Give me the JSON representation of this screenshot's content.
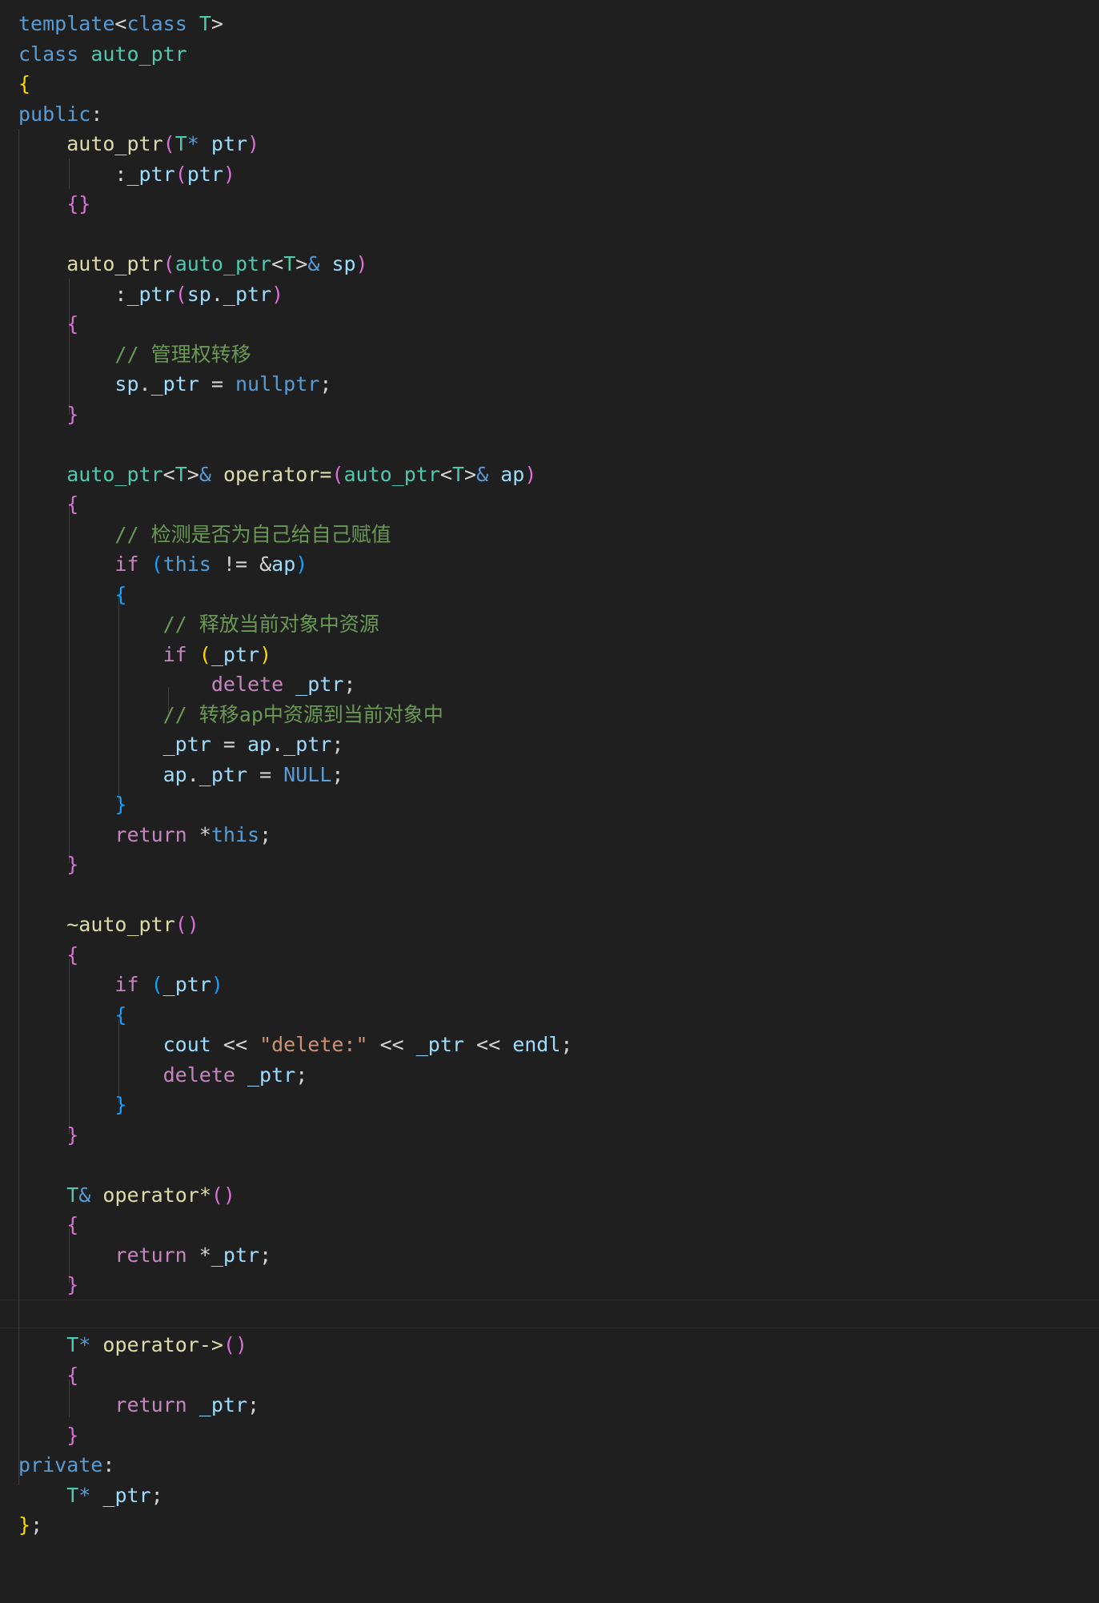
{
  "editor": {
    "language": "cpp",
    "theme_colors": {
      "background": "#1f1f1f",
      "keyword": "#569cd6",
      "control": "#c586c0",
      "type": "#4ec9b0",
      "function": "#dcdcaa",
      "variable": "#9cdcfe",
      "string": "#ce9178",
      "comment": "#6a9955",
      "text": "#d4d4d4",
      "bracket_level_1": "#ffd700",
      "bracket_level_2": "#da70d6",
      "bracket_level_3": "#179fff"
    },
    "lines": [
      [
        [
          "kw",
          "template"
        ],
        [
          "txt",
          "<"
        ],
        [
          "kw",
          "class"
        ],
        [
          "txt",
          " "
        ],
        [
          "type",
          "T"
        ],
        [
          "txt",
          ">"
        ]
      ],
      [
        [
          "kw",
          "class"
        ],
        [
          "txt",
          " "
        ],
        [
          "type",
          "auto_ptr"
        ]
      ],
      [
        [
          "b1",
          "{"
        ]
      ],
      [
        [
          "kw",
          "public"
        ],
        [
          "txt",
          ":"
        ]
      ],
      [
        [
          "txt",
          "    "
        ],
        [
          "fn",
          "auto_ptr"
        ],
        [
          "b2",
          "("
        ],
        [
          "type",
          "T"
        ],
        [
          "kw",
          "*"
        ],
        [
          "txt",
          " "
        ],
        [
          "var",
          "ptr"
        ],
        [
          "b2",
          ")"
        ]
      ],
      [
        [
          "txt",
          "        :"
        ],
        [
          "var",
          "_ptr"
        ],
        [
          "b2",
          "("
        ],
        [
          "var",
          "ptr"
        ],
        [
          "b2",
          ")"
        ]
      ],
      [
        [
          "txt",
          "    "
        ],
        [
          "b2",
          "{}"
        ]
      ],
      [],
      [
        [
          "txt",
          "    "
        ],
        [
          "fn",
          "auto_ptr"
        ],
        [
          "b2",
          "("
        ],
        [
          "type",
          "auto_ptr"
        ],
        [
          "txt",
          "<"
        ],
        [
          "type",
          "T"
        ],
        [
          "txt",
          ">"
        ],
        [
          "kw",
          "&"
        ],
        [
          "txt",
          " "
        ],
        [
          "var",
          "sp"
        ],
        [
          "b2",
          ")"
        ]
      ],
      [
        [
          "txt",
          "        :"
        ],
        [
          "var",
          "_ptr"
        ],
        [
          "b2",
          "("
        ],
        [
          "var",
          "sp"
        ],
        [
          "txt",
          "."
        ],
        [
          "var",
          "_ptr"
        ],
        [
          "b2",
          ")"
        ]
      ],
      [
        [
          "txt",
          "    "
        ],
        [
          "b2",
          "{"
        ]
      ],
      [
        [
          "txt",
          "        "
        ],
        [
          "com",
          "// 管理权转移"
        ]
      ],
      [
        [
          "txt",
          "        "
        ],
        [
          "var",
          "sp"
        ],
        [
          "txt",
          "."
        ],
        [
          "var",
          "_ptr"
        ],
        [
          "txt",
          " = "
        ],
        [
          "kw",
          "nullptr"
        ],
        [
          "txt",
          ";"
        ]
      ],
      [
        [
          "txt",
          "    "
        ],
        [
          "b2",
          "}"
        ]
      ],
      [],
      [
        [
          "txt",
          "    "
        ],
        [
          "type",
          "auto_ptr"
        ],
        [
          "txt",
          "<"
        ],
        [
          "type",
          "T"
        ],
        [
          "txt",
          ">"
        ],
        [
          "kw",
          "&"
        ],
        [
          "txt",
          " "
        ],
        [
          "fn",
          "operator="
        ],
        [
          "b2",
          "("
        ],
        [
          "type",
          "auto_ptr"
        ],
        [
          "txt",
          "<"
        ],
        [
          "type",
          "T"
        ],
        [
          "txt",
          ">"
        ],
        [
          "kw",
          "&"
        ],
        [
          "txt",
          " "
        ],
        [
          "var",
          "ap"
        ],
        [
          "b2",
          ")"
        ]
      ],
      [
        [
          "txt",
          "    "
        ],
        [
          "b2",
          "{"
        ]
      ],
      [
        [
          "txt",
          "        "
        ],
        [
          "com",
          "// 检测是否为自己给自己赋值"
        ]
      ],
      [
        [
          "txt",
          "        "
        ],
        [
          "ctl",
          "if"
        ],
        [
          "txt",
          " "
        ],
        [
          "b3",
          "("
        ],
        [
          "kw",
          "this"
        ],
        [
          "txt",
          " != &"
        ],
        [
          "var",
          "ap"
        ],
        [
          "b3",
          ")"
        ]
      ],
      [
        [
          "txt",
          "        "
        ],
        [
          "b3",
          "{"
        ]
      ],
      [
        [
          "txt",
          "            "
        ],
        [
          "com",
          "// 释放当前对象中资源"
        ]
      ],
      [
        [
          "txt",
          "            "
        ],
        [
          "ctl",
          "if"
        ],
        [
          "txt",
          " "
        ],
        [
          "b1",
          "("
        ],
        [
          "var",
          "_ptr"
        ],
        [
          "b1",
          ")"
        ]
      ],
      [
        [
          "txt",
          "                "
        ],
        [
          "ctl",
          "delete"
        ],
        [
          "txt",
          " "
        ],
        [
          "var",
          "_ptr"
        ],
        [
          "txt",
          ";"
        ]
      ],
      [
        [
          "txt",
          "            "
        ],
        [
          "com",
          "// 转移ap中资源到当前对象中"
        ]
      ],
      [
        [
          "txt",
          "            "
        ],
        [
          "var",
          "_ptr"
        ],
        [
          "txt",
          " = "
        ],
        [
          "var",
          "ap"
        ],
        [
          "txt",
          "."
        ],
        [
          "var",
          "_ptr"
        ],
        [
          "txt",
          ";"
        ]
      ],
      [
        [
          "txt",
          "            "
        ],
        [
          "var",
          "ap"
        ],
        [
          "txt",
          "."
        ],
        [
          "var",
          "_ptr"
        ],
        [
          "txt",
          " = "
        ],
        [
          "mac",
          "NULL"
        ],
        [
          "txt",
          ";"
        ]
      ],
      [
        [
          "txt",
          "        "
        ],
        [
          "b3",
          "}"
        ]
      ],
      [
        [
          "txt",
          "        "
        ],
        [
          "ctl",
          "return"
        ],
        [
          "txt",
          " *"
        ],
        [
          "kw",
          "this"
        ],
        [
          "txt",
          ";"
        ]
      ],
      [
        [
          "txt",
          "    "
        ],
        [
          "b2",
          "}"
        ]
      ],
      [],
      [
        [
          "txt",
          "    "
        ],
        [
          "fn",
          "~auto_ptr"
        ],
        [
          "b2",
          "()"
        ]
      ],
      [
        [
          "txt",
          "    "
        ],
        [
          "b2",
          "{"
        ]
      ],
      [
        [
          "txt",
          "        "
        ],
        [
          "ctl",
          "if"
        ],
        [
          "txt",
          " "
        ],
        [
          "b3",
          "("
        ],
        [
          "var",
          "_ptr"
        ],
        [
          "b3",
          ")"
        ]
      ],
      [
        [
          "txt",
          "        "
        ],
        [
          "b3",
          "{"
        ]
      ],
      [
        [
          "txt",
          "            "
        ],
        [
          "var",
          "cout"
        ],
        [
          "txt",
          " << "
        ],
        [
          "str",
          "\"delete:\""
        ],
        [
          "txt",
          " << "
        ],
        [
          "var",
          "_ptr"
        ],
        [
          "txt",
          " << "
        ],
        [
          "var",
          "endl"
        ],
        [
          "txt",
          ";"
        ]
      ],
      [
        [
          "txt",
          "            "
        ],
        [
          "ctl",
          "delete"
        ],
        [
          "txt",
          " "
        ],
        [
          "var",
          "_ptr"
        ],
        [
          "txt",
          ";"
        ]
      ],
      [
        [
          "txt",
          "        "
        ],
        [
          "b3",
          "}"
        ]
      ],
      [
        [
          "txt",
          "    "
        ],
        [
          "b2",
          "}"
        ]
      ],
      [],
      [
        [
          "txt",
          "    "
        ],
        [
          "type",
          "T"
        ],
        [
          "kw",
          "&"
        ],
        [
          "txt",
          " "
        ],
        [
          "fn",
          "operator*"
        ],
        [
          "b2",
          "()"
        ]
      ],
      [
        [
          "txt",
          "    "
        ],
        [
          "b2",
          "{"
        ]
      ],
      [
        [
          "txt",
          "        "
        ],
        [
          "ctl",
          "return"
        ],
        [
          "txt",
          " *"
        ],
        [
          "var",
          "_ptr"
        ],
        [
          "txt",
          ";"
        ]
      ],
      [
        [
          "txt",
          "    "
        ],
        [
          "b2",
          "}"
        ]
      ],
      [],
      [
        [
          "txt",
          "    "
        ],
        [
          "type",
          "T"
        ],
        [
          "kw",
          "*"
        ],
        [
          "txt",
          " "
        ],
        [
          "fn",
          "operator->"
        ],
        [
          "b2",
          "()"
        ]
      ],
      [
        [
          "txt",
          "    "
        ],
        [
          "b2",
          "{"
        ]
      ],
      [
        [
          "txt",
          "        "
        ],
        [
          "ctl",
          "return"
        ],
        [
          "txt",
          " "
        ],
        [
          "var",
          "_ptr"
        ],
        [
          "txt",
          ";"
        ]
      ],
      [
        [
          "txt",
          "    "
        ],
        [
          "b2",
          "}"
        ]
      ],
      [
        [
          "kw",
          "private"
        ],
        [
          "txt",
          ":"
        ]
      ],
      [
        [
          "txt",
          "    "
        ],
        [
          "type",
          "T"
        ],
        [
          "kw",
          "*"
        ],
        [
          "txt",
          " "
        ],
        [
          "var",
          "_ptr"
        ],
        [
          "txt",
          ";"
        ]
      ],
      [
        [
          "b1",
          "}"
        ],
        [
          "txt",
          ";"
        ]
      ]
    ]
  }
}
